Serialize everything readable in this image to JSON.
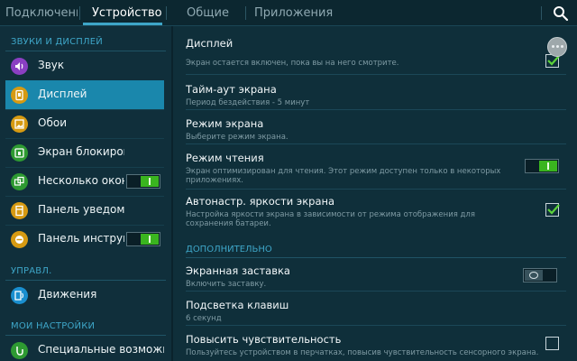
{
  "tabs": [
    {
      "label": "Подключени..."
    },
    {
      "label": "Устройство"
    },
    {
      "label": "Общие"
    },
    {
      "label": "Приложения"
    }
  ],
  "sidebar": {
    "sections": [
      {
        "header": "ЗВУКИ И ДИСПЛЕЙ"
      },
      {
        "header": "УПРАВЛ."
      },
      {
        "header": "МОИ НАСТРОЙКИ"
      }
    ],
    "items": [
      {
        "label": "Звук",
        "icon": "speaker-icon",
        "color": "#8a3fc2"
      },
      {
        "label": "Дисплей",
        "icon": "display-icon",
        "color": "#d69a12",
        "selected": true
      },
      {
        "label": "Обои",
        "icon": "wallpaper-icon",
        "color": "#d69a12"
      },
      {
        "label": "Экран блокировки",
        "icon": "lock-icon",
        "color": "#2e9a32"
      },
      {
        "label": "Несколько окон",
        "icon": "multiwindow-icon",
        "color": "#2e9a32",
        "toggle": "on"
      },
      {
        "label": "Панель уведомлений",
        "icon": "notification-panel-icon",
        "color": "#d69a12"
      },
      {
        "label": "Панель инструм...",
        "icon": "toolbox-icon",
        "color": "#d69a12",
        "toggle": "on"
      },
      {
        "label": "Движения",
        "icon": "motion-icon",
        "color": "#1a8fcf"
      },
      {
        "label": "Специальные возможно...",
        "icon": "accessibility-icon",
        "color": "#2e9a32"
      }
    ]
  },
  "main": {
    "rows": [
      {
        "title": "Дисплей",
        "subtitle": "Экран остается включен, пока вы на него смотрите.",
        "control": "checkbox-checked"
      },
      {
        "title": "Тайм-аут экрана",
        "subtitle": "Период бездействия - 5 минут"
      },
      {
        "title": "Режим экрана",
        "subtitle": "Выберите режим экрана."
      },
      {
        "title": "Режим чтения",
        "subtitle": "Экран оптимизирован для чтения. Этот режим доступен только в некоторых приложениях.",
        "control": "toggle-on"
      },
      {
        "title": "Автонастр. яркости экрана",
        "subtitle": "Настройка яркости экрана в зависимости от режима отображения для сохранения батареи.",
        "control": "checkbox-checked"
      },
      {
        "title": "Экранная заставка",
        "subtitle": "Включить заставку.",
        "control": "toggle-off"
      },
      {
        "title": "Подсветка клавиш",
        "subtitle": "6 секунд"
      },
      {
        "title": "Повысить чувствительность",
        "subtitle": "Пользуйтесь устройством в перчатках, повысив чувствительность сенсорного экрана.",
        "control": "checkbox-unchecked"
      }
    ],
    "advanced_header": "ДОПОЛНИТЕЛЬНО"
  },
  "colors": {
    "accent": "#3ea6c8",
    "selected": "#1a87ac",
    "toggle_on": "#3ab51f",
    "check": "#5bd23a"
  }
}
